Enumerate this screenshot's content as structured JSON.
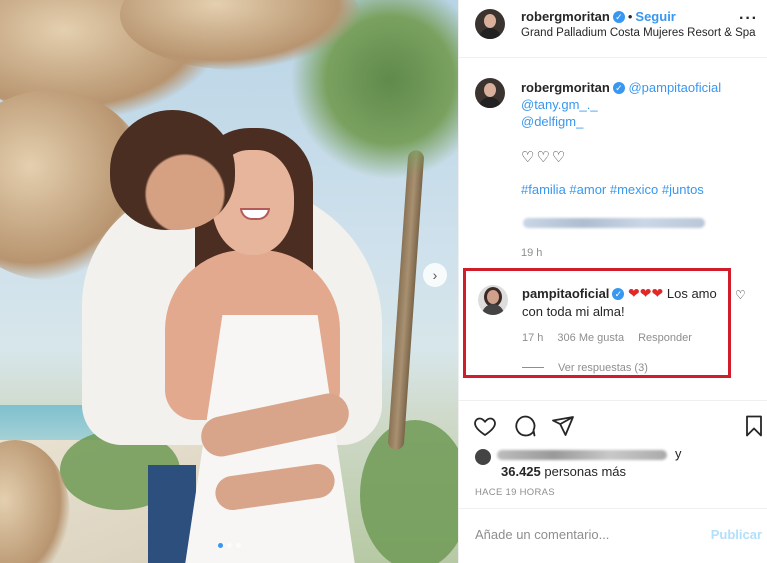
{
  "post": {
    "author": "robergmoritan",
    "follow_label": "Seguir",
    "separator": "•",
    "location": "Grand Palladium Costa Mujeres Resort & Spa",
    "more_icon": "ellipsis-icon"
  },
  "caption": {
    "author": "robergmoritan",
    "mentions": [
      "@pampitaoficial",
      "@tany.gm_._",
      "@delfigm_"
    ],
    "hearts": "♡♡♡",
    "hashtags": "#familia #amor #mexico #juntos",
    "time": "19 h"
  },
  "comment": {
    "author": "pampitaoficial",
    "hearts": "❤❤❤",
    "text": "Los amo con toda mi alma!",
    "time": "17 h",
    "likes": "306 Me gusta",
    "reply_label": "Responder",
    "view_replies": "Ver respuestas (3)"
  },
  "actions": {
    "like_icon": "heart-icon",
    "comment_icon": "comment-icon",
    "share_icon": "share-icon",
    "save_icon": "bookmark-icon"
  },
  "likes": {
    "y": "y",
    "count": "36.425",
    "suffix": " personas más"
  },
  "posted_ago": "HACE 19 HORAS",
  "add_comment": {
    "placeholder": "Añade un comentario...",
    "publish_label": "Publicar"
  },
  "colors": {
    "accent": "#3897f0",
    "highlight_border": "#d01c2b",
    "heart_red": "#e02828",
    "muted": "#8e8e8e"
  }
}
